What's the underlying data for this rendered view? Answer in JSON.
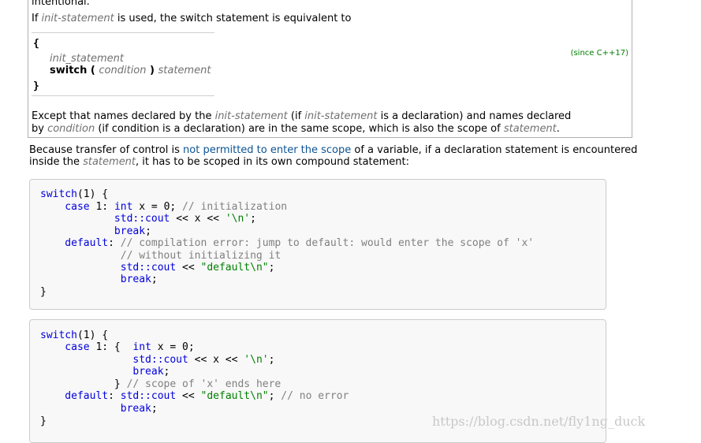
{
  "box": {
    "top_text": "intentional.",
    "equiv_prefix": "If ",
    "equiv_term": "init-statement",
    "equiv_suffix": " is used, the switch statement is equivalent to",
    "open_brace": "{",
    "init_statement": "init_statement",
    "switch_kw": "switch",
    "paren_open": " ( ",
    "condition": "condition",
    "paren_close": " ) ",
    "statement": "statement",
    "close_brace": "}",
    "since": "(since C++17)",
    "except_1a": "Except that names declared by the ",
    "except_1b": "init-statement",
    "except_1c": " (if ",
    "except_1d": "init-statement",
    "except_1e": " is a declaration) and names declared",
    "except_2a": "by ",
    "except_2b": "condition",
    "except_2c": " (if condition is a declaration) are in the same scope, which is also the scope of ",
    "except_2d": "statement",
    "except_2e": "."
  },
  "para": {
    "l1a": "Because transfer of control is ",
    "l1link": "not permitted to enter the scope",
    "l1b": " of a variable, if a declaration statement is encountered",
    "l2a": "inside the ",
    "l2b": "statement",
    "l2c": ", it has to be scoped in its own compound statement:"
  },
  "code1": {
    "l1a": "switch",
    "l1b": "(1) {",
    "l2a": "    case ",
    "l2b": "1",
    "l2c": ": ",
    "l2d": "int",
    "l2e": " x = ",
    "l2f": "0",
    "l2g": "; ",
    "l2h": "// initialization",
    "l3a": "            std::cout",
    "l3b": " << x << ",
    "l3c": "'\\n'",
    "l3d": ";",
    "l4a": "            break",
    "l4b": ";",
    "l5a": "    default",
    "l5b": ": ",
    "l5c": "// compilation error: jump to default: would enter the scope of 'x'",
    "l6a": "             // without initializing it",
    "l7a": "             std::cout",
    "l7b": " << ",
    "l7c": "\"default\\n\"",
    "l7d": ";",
    "l8a": "             break",
    "l8b": ";",
    "l9a": "}"
  },
  "code2": {
    "l1a": "switch",
    "l1b": "(1) {",
    "l2a": "    case ",
    "l2b": "1",
    "l2c": ": {  ",
    "l2d": "int",
    "l2e": " x = ",
    "l2f": "0",
    "l2g": ";",
    "l3a": "               std::cout",
    "l3b": " << x << ",
    "l3c": "'\\n'",
    "l3d": ";",
    "l4a": "               break",
    "l4b": ";",
    "l5a": "            } ",
    "l5b": "// scope of 'x' ends here",
    "l6a": "    default",
    "l6b": ": ",
    "l6c": "std::cout",
    "l6d": " << ",
    "l6e": "\"default\\n\"",
    "l6f": "; ",
    "l6g": "// no error",
    "l7a": "             break",
    "l7b": ";",
    "l8a": "}"
  },
  "watermark": "https://blog.csdn.net/fly1ng_duck"
}
